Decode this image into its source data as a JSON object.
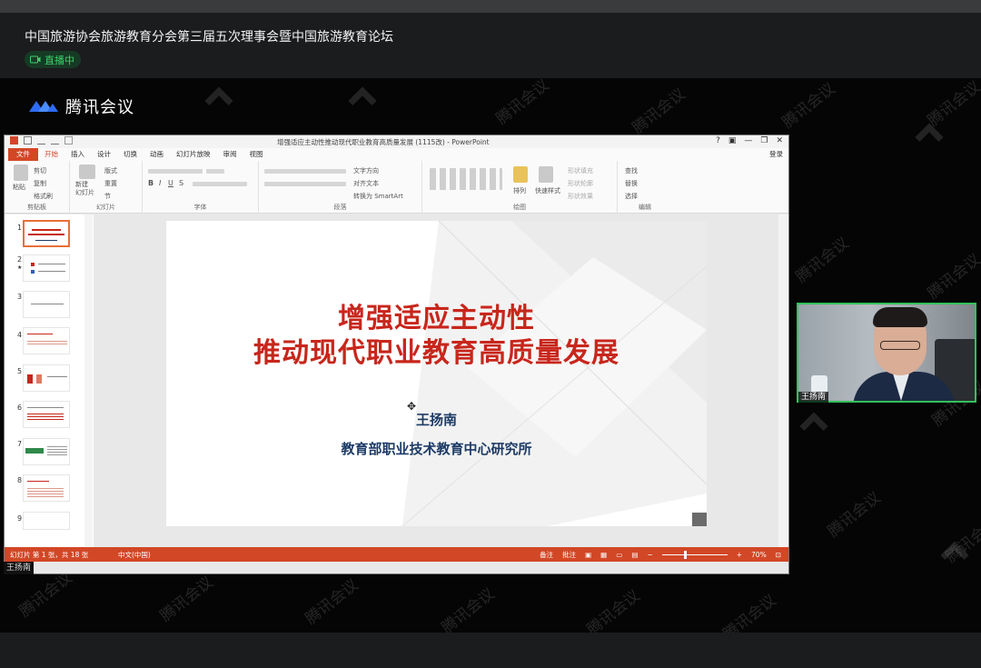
{
  "meeting": {
    "title": "中国旅游协会旅游教育分会第三届五次理事会暨中国旅游教育论坛",
    "live_status": "直播中",
    "brand": "腾讯会议",
    "watermark_text": "腾讯会议"
  },
  "ppt": {
    "window_title": "增强适应主动性推动现代职业教育高质量发展 (1115改) - PowerPoint",
    "tabs": [
      "文件",
      "开始",
      "插入",
      "设计",
      "切换",
      "动画",
      "幻灯片放映",
      "审阅",
      "视图"
    ],
    "active_tab": "开始",
    "login": "登录",
    "window_controls": [
      "?",
      "▣",
      "—",
      "❐",
      "✕"
    ],
    "ribbon": {
      "clipboard": {
        "label": "剪贴板",
        "paste": "粘贴",
        "cut": "剪切",
        "copy": "复制",
        "format_painter": "格式刷"
      },
      "slides": {
        "label": "幻灯片",
        "new_slide": "新建\n幻灯片",
        "layout": "版式",
        "reset": "重置",
        "section": "节"
      },
      "font": {
        "label": "字体"
      },
      "paragraph": {
        "label": "段落",
        "text_direction": "文字方向",
        "align_text": "对齐文本",
        "smartart": "转换为 SmartArt"
      },
      "drawing": {
        "label": "绘图",
        "arrange": "排列",
        "quick_styles": "快速样式",
        "shape_fill": "形状填充",
        "shape_outline": "形状轮廓",
        "shape_effects": "形状效果"
      },
      "editing": {
        "label": "编辑",
        "find": "查找",
        "replace": "替换",
        "select": "选择"
      }
    },
    "thumbnails": [
      {
        "num": "1",
        "star": false
      },
      {
        "num": "2",
        "star": true
      },
      {
        "num": "3",
        "star": false
      },
      {
        "num": "4",
        "star": false
      },
      {
        "num": "5",
        "star": false
      },
      {
        "num": "6",
        "star": false
      },
      {
        "num": "7",
        "star": false
      },
      {
        "num": "8",
        "star": false
      },
      {
        "num": "9",
        "star": false
      }
    ],
    "slide": {
      "title_line1": "增强适应主动性",
      "title_line2": "推动现代职业教育高质量发展",
      "author": "王扬南",
      "organization": "教育部职业技术教育中心研究所"
    },
    "status": {
      "slide_info": "幻灯片 第 1 张，共 18 张",
      "language": "中文(中国)",
      "notes": "备注",
      "comments": "批注",
      "zoom": "70%",
      "zoom_level": 0.7
    }
  },
  "presenter": {
    "share_label": "王扬南",
    "video_name": "王扬南"
  },
  "colors": {
    "ppt_accent": "#d24726",
    "live_green": "#3cd26b",
    "slide_title": "#c8261c",
    "slide_body": "#1d3b66",
    "speaker_border": "#33c15b"
  }
}
